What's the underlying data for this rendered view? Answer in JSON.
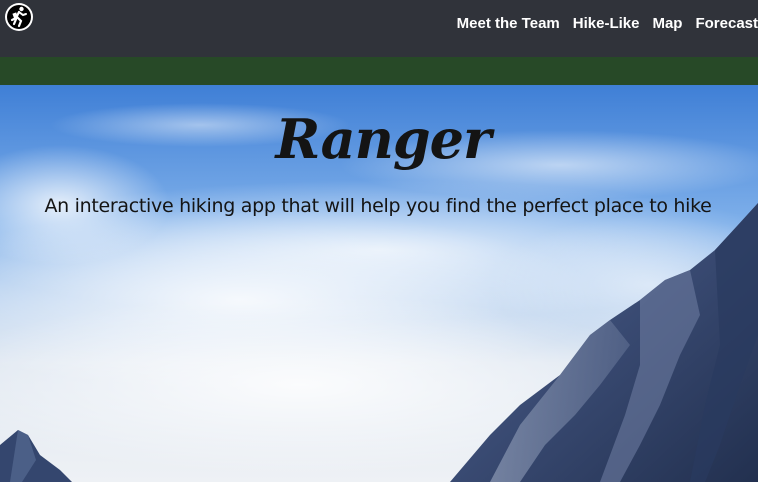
{
  "nav": {
    "logo_icon": "hiker-icon",
    "links": [
      {
        "label": "Meet the Team"
      },
      {
        "label": "Hike-Like"
      },
      {
        "label": "Map"
      },
      {
        "label": "Forecast"
      }
    ]
  },
  "hero": {
    "title": "Ranger",
    "subtitle": "An interactive hiking app that will help you find the perfect place to hike"
  },
  "colors": {
    "navbar": "#30333a",
    "band": "#274927",
    "text": "#141414"
  }
}
